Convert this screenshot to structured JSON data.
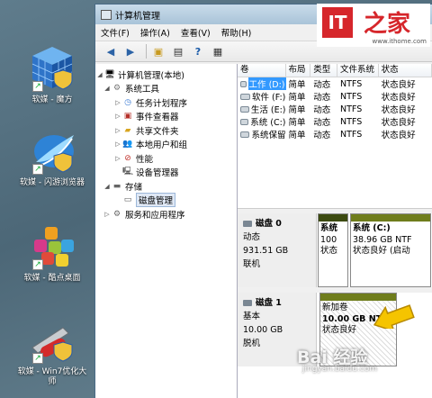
{
  "desktop": {
    "icons": [
      {
        "label": "软媒 - 魔方"
      },
      {
        "label": "软媒 - 闪游浏览器"
      },
      {
        "label": "软媒 - 酷点桌面"
      },
      {
        "label": "软媒 - Win7优化大师"
      }
    ]
  },
  "logo": {
    "brand": "IT",
    "chinese": "之家",
    "url": "www.ithome.com"
  },
  "window": {
    "title": "计算机管理",
    "menu": [
      "文件(F)",
      "操作(A)",
      "查看(V)",
      "帮助(H)"
    ]
  },
  "tree": {
    "root": "计算机管理(本地)",
    "system_tools": "系统工具",
    "items": [
      "任务计划程序",
      "事件查看器",
      "共享文件夹",
      "本地用户和组",
      "性能",
      "设备管理器"
    ],
    "storage": "存储",
    "disk_mgmt": "磁盘管理",
    "services": "服务和应用程序"
  },
  "volumes": {
    "headers": [
      "卷",
      "布局",
      "类型",
      "文件系统",
      "状态"
    ],
    "rows": [
      {
        "name": "工作 (D:)",
        "layout": "简单",
        "type": "动态",
        "fs": "NTFS",
        "status": "状态良好"
      },
      {
        "name": "软件 (F:)",
        "layout": "简单",
        "type": "动态",
        "fs": "NTFS",
        "status": "状态良好"
      },
      {
        "name": "生活 (E:)",
        "layout": "简单",
        "type": "动态",
        "fs": "NTFS",
        "status": "状态良好"
      },
      {
        "name": "系统 (C:)",
        "layout": "简单",
        "type": "动态",
        "fs": "NTFS",
        "status": "状态良好"
      },
      {
        "name": "系统保留",
        "layout": "简单",
        "type": "动态",
        "fs": "NTFS",
        "status": "状态良好"
      }
    ]
  },
  "disk0": {
    "name": "磁盘 0",
    "type": "动态",
    "size": "931.51 GB",
    "state": "联机",
    "p1": {
      "name": "系统",
      "size": "100",
      "status": "状态"
    },
    "p2": {
      "name": "系统 (C:)",
      "size": "38.96 GB NTF",
      "status": "状态良好 (启动"
    }
  },
  "disk1": {
    "name": "磁盘 1",
    "type": "基本",
    "size": "10.00 GB",
    "state": "脱机",
    "p1": {
      "name": "新加卷",
      "size": "10.00 GB NTFS",
      "status": "状态良好"
    }
  },
  "watermark": {
    "text": "Bai 经验",
    "sub": "jingyan.baidu.com"
  },
  "colors": {
    "accent_arrow": "#f5c400",
    "partition_bar": "#6f7d1c",
    "selection": "#3399ff"
  }
}
